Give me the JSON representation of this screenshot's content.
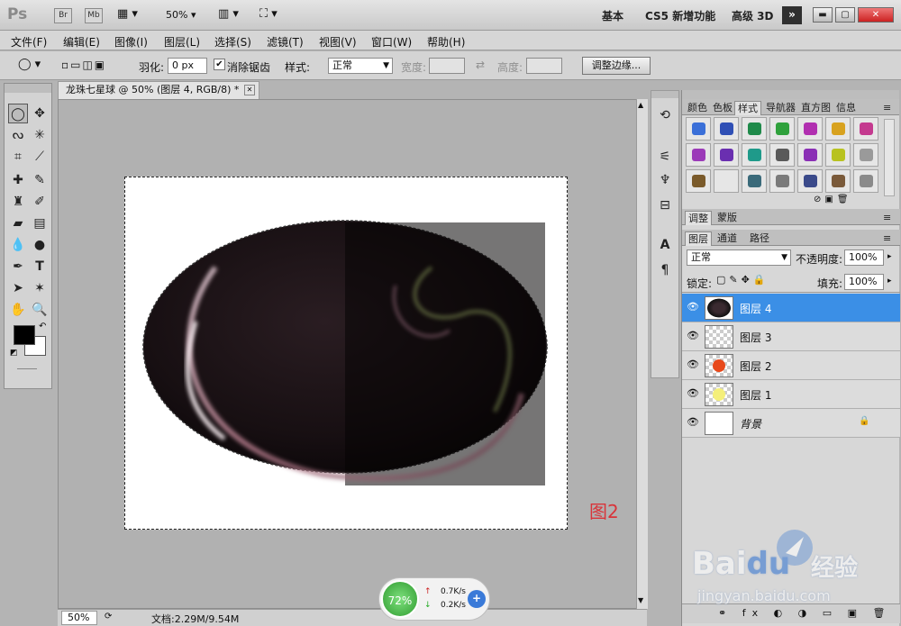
{
  "app": {
    "logo": "Ps",
    "bridge_label": "Br",
    "minibridge_label": "Mb",
    "zoom": "50%",
    "workspaces": [
      "基本",
      "CS5 新增功能",
      "高级 3D"
    ],
    "more_label": "»"
  },
  "menu": [
    "文件(F)",
    "编辑(E)",
    "图像(I)",
    "图层(L)",
    "选择(S)",
    "滤镜(T)",
    "视图(V)",
    "窗口(W)",
    "帮助(H)"
  ],
  "options": {
    "feather_label": "羽化:",
    "feather_value": "0 px",
    "antialias_label": "消除锯齿",
    "style_label": "样式:",
    "style_value": "正常",
    "width_label": "宽度:",
    "height_label": "高度:",
    "refine_edge_label": "调整边缘..."
  },
  "document": {
    "tab_title": "龙珠七星球 @ 50% (图层 4, RGB/8) *",
    "figure_label": "图2"
  },
  "status": {
    "zoom": "50%",
    "doc_size": "文档:2.29M/9.54M"
  },
  "panels": {
    "top_tabs": [
      "颜色",
      "色板",
      "样式",
      "导航器",
      "直方图",
      "信息"
    ],
    "mid_tabs": [
      "调整",
      "蒙版"
    ],
    "layer_tabs": [
      "图层",
      "通道",
      "路径"
    ],
    "blend_mode": "正常",
    "opacity_label": "不透明度:",
    "opacity_value": "100%",
    "lock_label": "锁定:",
    "fill_label": "填充:",
    "fill_value": "100%",
    "layers": [
      {
        "name": "图层 4",
        "selected": true
      },
      {
        "name": "图层 3",
        "selected": false
      },
      {
        "name": "图层 2",
        "selected": false
      },
      {
        "name": "图层 1",
        "selected": false
      },
      {
        "name": "背景",
        "selected": false
      }
    ],
    "style_colors": [
      "#3a6fd8",
      "#2f4fb5",
      "#1f8a4a",
      "#2fa13c",
      "#b12fb0",
      "#d8a21f",
      "#c43a8f",
      "#9b3ab8",
      "#6a2fb0",
      "#1f9a8a",
      "#5a5a5a",
      "#8a2fb5",
      "#b8c21f",
      "#9a9a9a",
      "#7a5a2a",
      "#e6e6e6",
      "#3a6a7a",
      "#7a7a7a",
      "#3a4a8a",
      "#7a5a3a",
      "#8a8a8a"
    ]
  },
  "network": {
    "percent": "72%",
    "up": "0.7K/s",
    "down": "0.2K/s"
  },
  "watermark": {
    "brand": "Bai",
    "brand2": "du",
    "brand_cn": "经验",
    "url": "jingyan.baidu.com"
  }
}
